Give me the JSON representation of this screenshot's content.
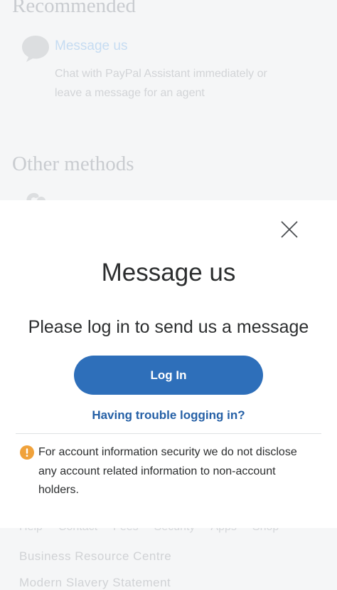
{
  "background": {
    "recommended_heading": "Recommended",
    "message_link": "Message us",
    "message_description": "Chat with PayPal Assistant immediately or leave a message for an agent",
    "other_heading": "Other methods",
    "footer_links": [
      "Help",
      "Contact",
      "Fees",
      "Security",
      "Apps",
      "Shop"
    ],
    "footer_line_1": "Business Resource Centre",
    "footer_line_2": "Modern Slavery Statement"
  },
  "modal": {
    "title": "Message us",
    "prompt": "Please log in to send us a message",
    "login_label": "Log In",
    "trouble_label": "Having trouble logging in?",
    "security_note": "For account information security we do not disclose any account related information to non-account holders."
  },
  "colors": {
    "primary_button": "#2e6fba",
    "link": "#2560a6",
    "warning": "#f0a23b",
    "text": "#2c2e2f"
  },
  "icons": {
    "close": "close-icon",
    "warning": "warning-icon",
    "chat": "chat-bubble-icon",
    "phone": "phone-icon"
  }
}
